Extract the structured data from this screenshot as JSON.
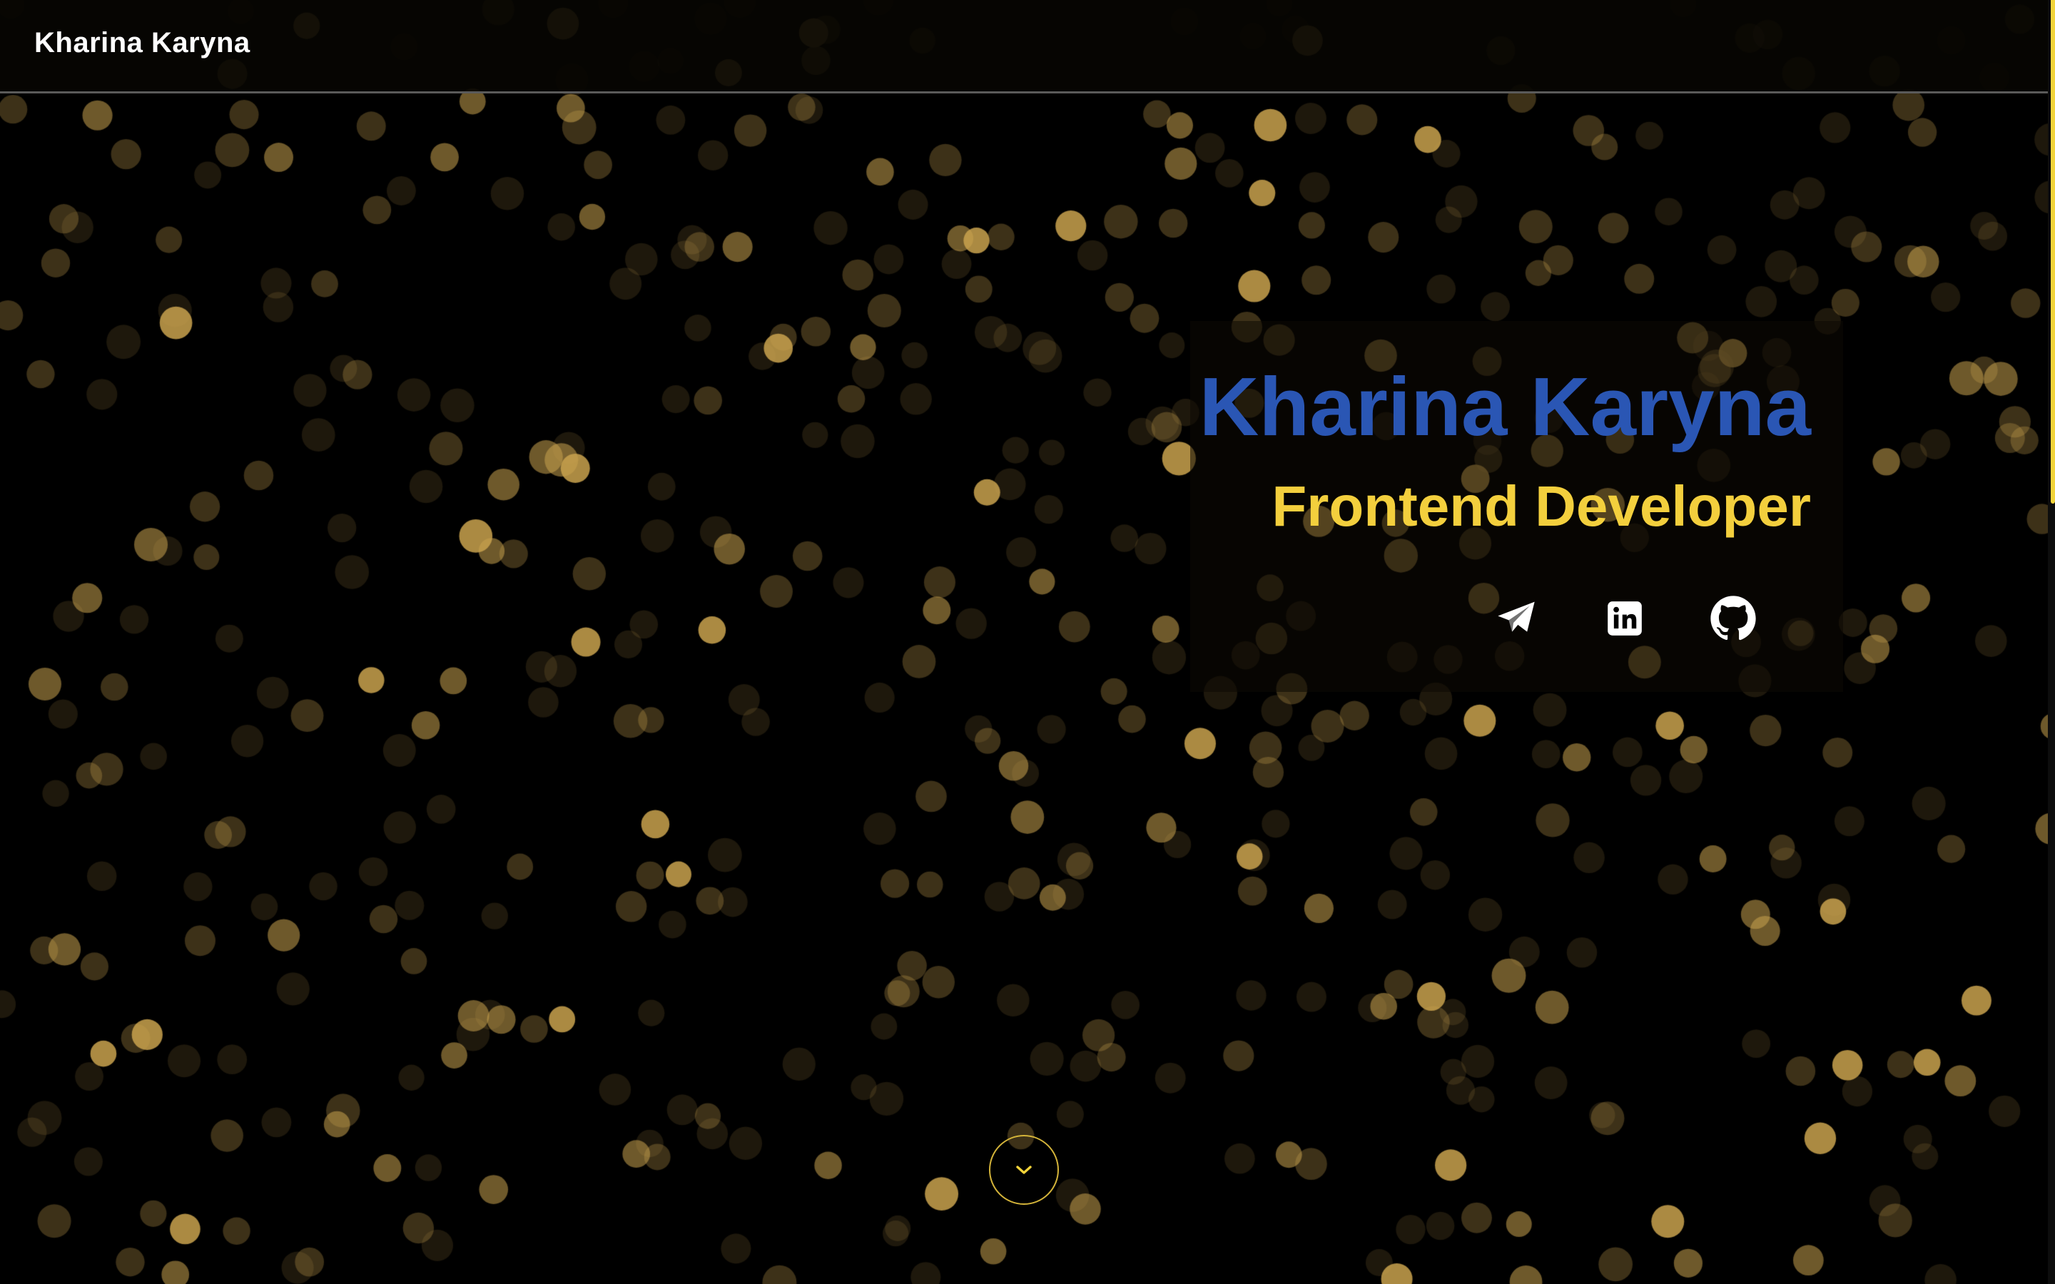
{
  "header": {
    "brand": "Kharina Karyna"
  },
  "hero": {
    "name": "Kharina Karyna",
    "role": "Frontend Developer"
  },
  "socials": [
    {
      "icon": "telegram-icon",
      "label": "Telegram"
    },
    {
      "icon": "linkedin-icon",
      "label": "LinkedIn"
    },
    {
      "icon": "github-icon",
      "label": "GitHub"
    }
  ],
  "scroll": {
    "icon": "chevron-down-icon"
  },
  "colors": {
    "background": "#000000",
    "name": "#2a56b4",
    "role": "#f3cf3d",
    "accent": "#d4b43a",
    "bokeh": "#c9a24e"
  }
}
